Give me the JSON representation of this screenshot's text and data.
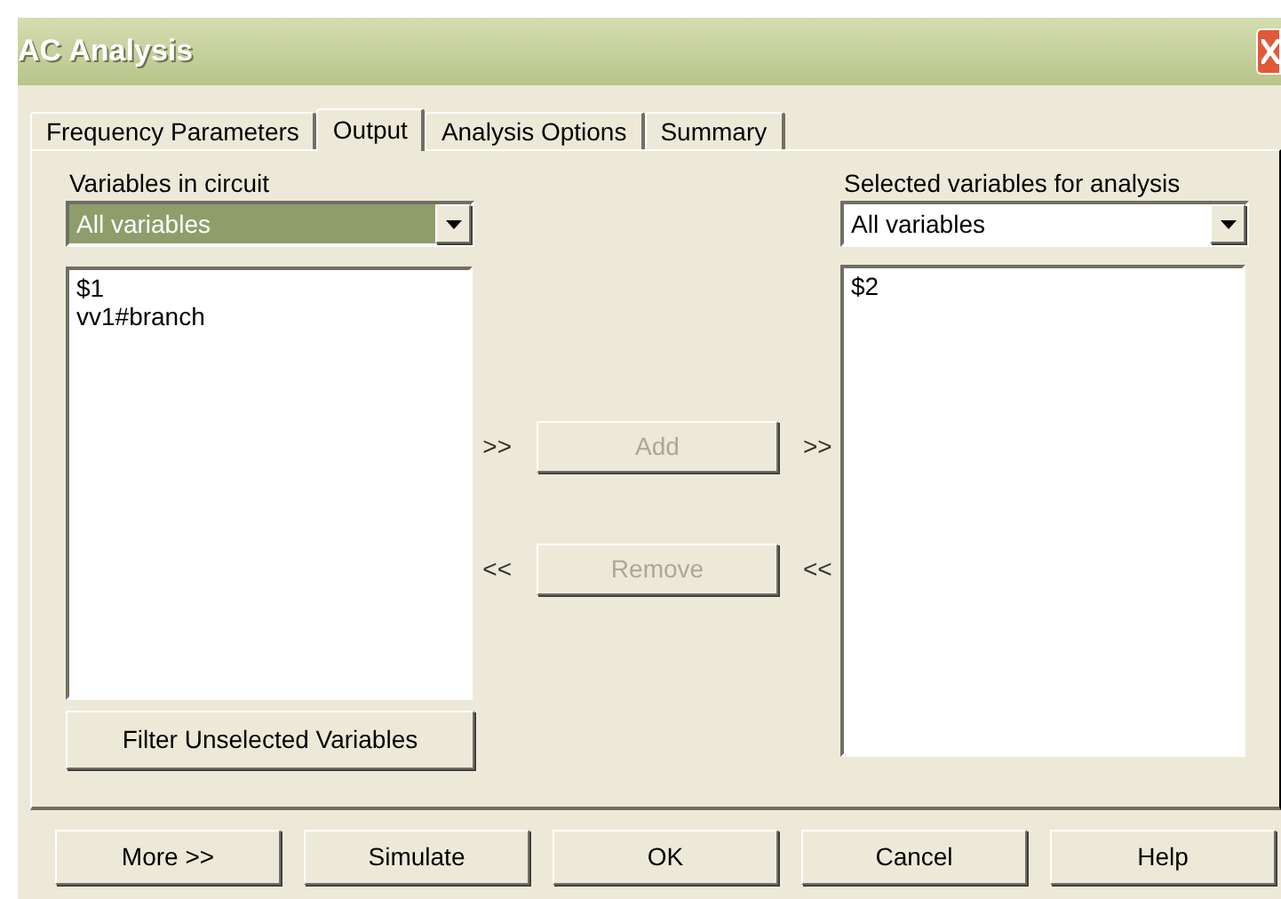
{
  "window": {
    "title": "AC Analysis"
  },
  "tabs": [
    {
      "label": "Frequency Parameters",
      "selected": false
    },
    {
      "label": "Output",
      "selected": true
    },
    {
      "label": "Analysis Options",
      "selected": false
    },
    {
      "label": "Summary",
      "selected": false
    }
  ],
  "left": {
    "label": "Variables in circuit",
    "dropdown": {
      "value": "All variables",
      "highlighted": true
    },
    "items": [
      "$1",
      "vv1#branch"
    ],
    "filter_button": "Filter Unselected Variables"
  },
  "middle": [
    {
      "arrow_left": ">>",
      "button": "Add",
      "arrow_right": ">>",
      "disabled": true
    },
    {
      "arrow_left": "<<",
      "button": "Remove",
      "arrow_right": "<<",
      "disabled": true
    }
  ],
  "right": {
    "label": "Selected variables for analysis",
    "dropdown": {
      "value": "All variables",
      "highlighted": false
    },
    "items": [
      "$2"
    ]
  },
  "buttons": [
    "More >>",
    "Simulate",
    "OK",
    "Cancel",
    "Help"
  ]
}
